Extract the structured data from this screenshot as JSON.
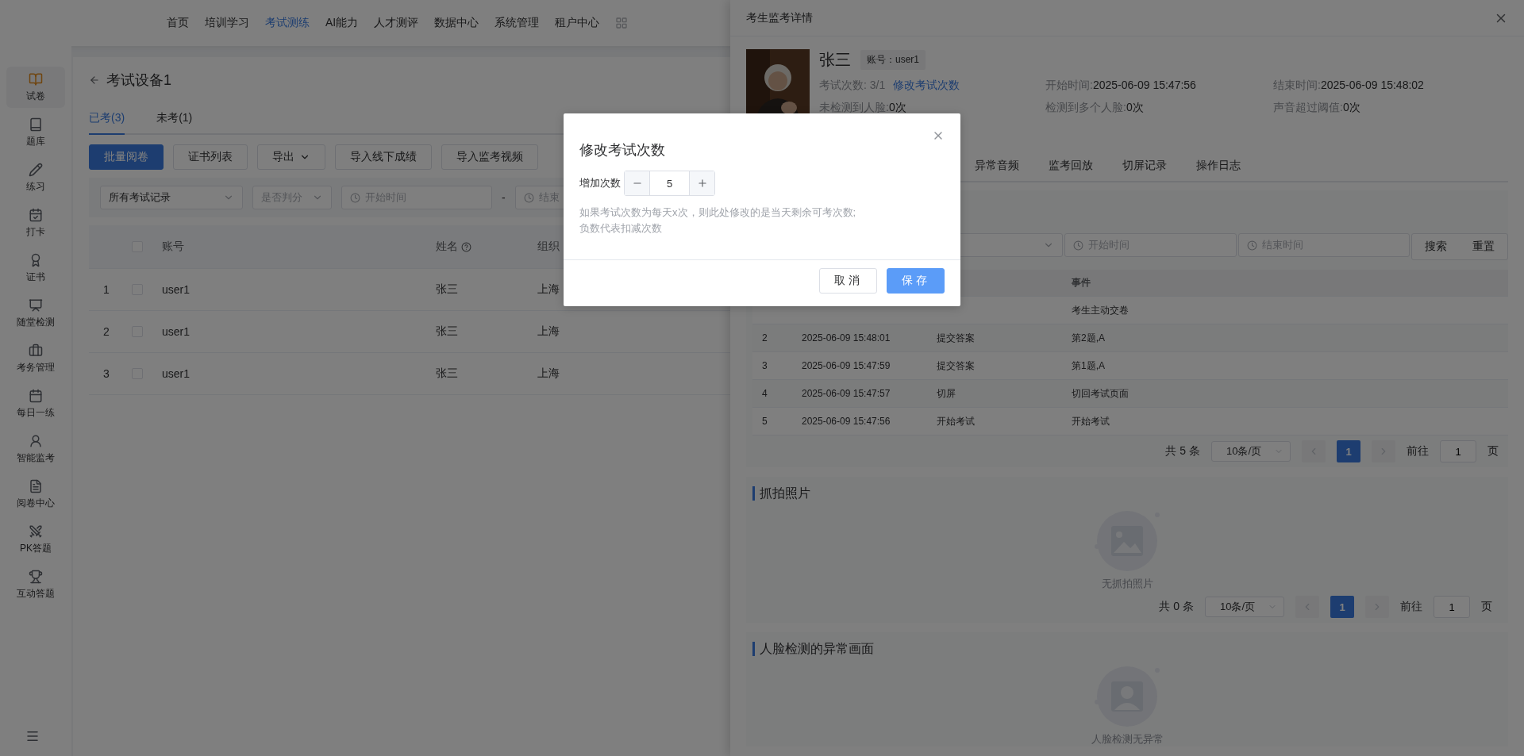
{
  "top_nav": {
    "items": [
      {
        "label": "首页",
        "selected": false
      },
      {
        "label": "培训学习",
        "selected": false
      },
      {
        "label": "考试测练",
        "selected": true
      },
      {
        "label": "AI能力",
        "selected": false
      },
      {
        "label": "人才测评",
        "selected": false
      },
      {
        "label": "数据中心",
        "selected": false
      },
      {
        "label": "系统管理",
        "selected": false
      },
      {
        "label": "租户中心",
        "selected": false
      }
    ]
  },
  "sidebar": {
    "items": [
      {
        "label": "试卷",
        "kind": "paper",
        "selected": true
      },
      {
        "label": "题库",
        "kind": "bank",
        "selected": false
      },
      {
        "label": "练习",
        "kind": "pen",
        "selected": false
      },
      {
        "label": "打卡",
        "kind": "checkin",
        "selected": false
      },
      {
        "label": "证书",
        "kind": "award",
        "selected": false
      },
      {
        "label": "随堂检测",
        "kind": "board",
        "selected": false
      },
      {
        "label": "考务管理",
        "kind": "case",
        "selected": false
      },
      {
        "label": "每日一练",
        "kind": "calendar",
        "selected": false
      },
      {
        "label": "智能监考",
        "kind": "user",
        "selected": false
      },
      {
        "label": "阅卷中心",
        "kind": "doc",
        "selected": false
      },
      {
        "label": "PK答题",
        "kind": "swords",
        "selected": false
      },
      {
        "label": "互动答题",
        "kind": "trophy",
        "selected": false
      }
    ]
  },
  "page": {
    "title": "考试设备1",
    "tabs": [
      {
        "label": "已考(3)",
        "selected": true
      },
      {
        "label": "未考(1)",
        "selected": false
      }
    ],
    "toolbar": [
      {
        "label": "批量阅卷",
        "kind": "primary"
      },
      {
        "label": "证书列表",
        "kind": "plain"
      },
      {
        "label": "导出",
        "kind": "dropdown"
      },
      {
        "label": "导入线下成绩",
        "kind": "plain"
      },
      {
        "label": "导入监考视频",
        "kind": "plain"
      }
    ],
    "filters": {
      "record": "所有考试记录",
      "judged_placeholder": "是否判分",
      "start_placeholder": "开始时间",
      "separator": "-",
      "end_placeholder": "结束"
    },
    "table": {
      "header_checked": false,
      "columns": [
        {
          "label": "账号",
          "help": false
        },
        {
          "label": "姓名",
          "help": true
        },
        {
          "label": "组织",
          "help": false
        }
      ],
      "rows": [
        {
          "index": "1",
          "checked": false,
          "account": "user1",
          "name": "张三",
          "org": "上海"
        },
        {
          "index": "2",
          "checked": false,
          "account": "user1",
          "name": "张三",
          "org": "上海"
        },
        {
          "index": "3",
          "checked": false,
          "account": "user1",
          "name": "张三",
          "org": "上海"
        }
      ]
    }
  },
  "drawer": {
    "title": "考生监考详情",
    "name": "张三",
    "account_tag": "账号：user1",
    "info": [
      {
        "label": "考试次数: 3/1",
        "link": "修改考试次数"
      },
      {
        "label": "开始时间:",
        "value": "2025-06-09 15:47:56"
      },
      {
        "label": "结束时间:",
        "value": "2025-06-09 15:48:02"
      },
      {
        "label": "未检测到人脸:",
        "value": "0次"
      },
      {
        "label": "检测到多个人脸:",
        "value": "0次"
      },
      {
        "label": "声音超过阈值:",
        "value": "0次"
      }
    ],
    "tabs": [
      {
        "label": "异常音频",
        "selected": false
      },
      {
        "label": "监考回放",
        "selected": false
      },
      {
        "label": "切屏记录",
        "selected": false
      },
      {
        "label": "操作日志",
        "selected": false
      }
    ],
    "log_filter": {
      "start_placeholder": "开始时间",
      "end_placeholder": "结束时间",
      "buttons": [
        "搜索",
        "重置"
      ]
    },
    "log_table": {
      "event_header": "事件",
      "rows": [
        {
          "event": "考生主动交卷"
        },
        {
          "index": "2",
          "time": "2025-06-09 15:48:01",
          "type": "提交答案",
          "event": "第2题,A"
        },
        {
          "index": "3",
          "time": "2025-06-09 15:47:59",
          "type": "提交答案",
          "event": "第1题,A"
        },
        {
          "index": "4",
          "time": "2025-06-09 15:47:57",
          "type": "切屏",
          "event": "切回考试页面"
        },
        {
          "index": "5",
          "time": "2025-06-09 15:47:56",
          "type": "开始考试",
          "event": "开始考试"
        }
      ],
      "pagination": {
        "total": "共 5 条",
        "page_size": "10条/页",
        "pages": [
          {
            "label": "1",
            "selected": true
          }
        ],
        "goto_label": "前往",
        "goto_value": "1",
        "suffix": "页"
      }
    },
    "sections": [
      {
        "title": "抓拍照片",
        "empty_text": "无抓拍照片",
        "pagination": {
          "total": "共 0 条",
          "page_size": "10条/页",
          "pages": [
            {
              "label": "1",
              "selected": true
            }
          ],
          "goto_label": "前往",
          "goto_value": "1",
          "suffix": "页"
        }
      },
      {
        "title": "人脸检测的异常画面",
        "kind": "face",
        "empty_text": "人脸检测无异常"
      }
    ]
  },
  "modal": {
    "title": "修改考试次数",
    "field_label": "增加次数",
    "value": "5",
    "hint_lines": [
      "如果考试次数为每天x次，则此处修改的是当天剩余可考次数;",
      "负数代表扣减次数"
    ],
    "buttons": [
      {
        "label": "取消",
        "kind": "default"
      },
      {
        "label": "保存",
        "kind": "primary"
      }
    ]
  }
}
